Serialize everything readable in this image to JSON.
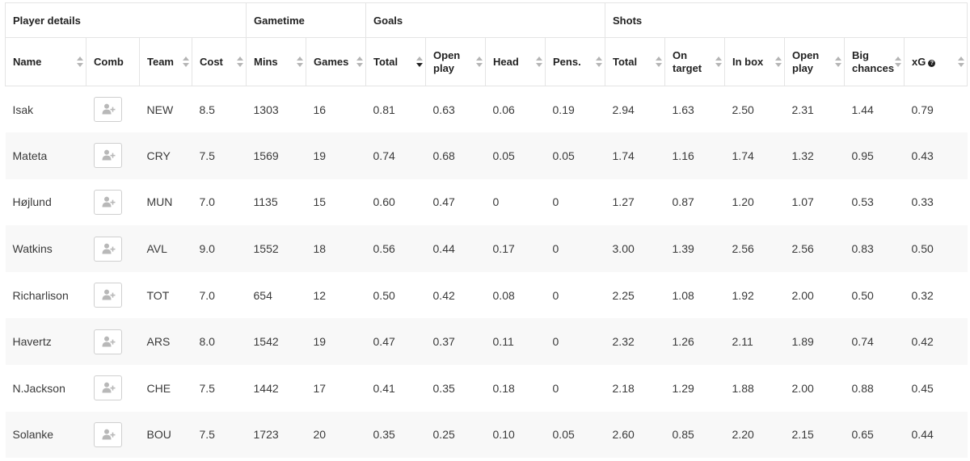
{
  "groups": [
    "Player details",
    "Gametime",
    "Goals",
    "Shots"
  ],
  "columns": [
    {
      "line1": "Name",
      "line2": ""
    },
    {
      "line1": "Comb",
      "line2": ""
    },
    {
      "line1": "Team",
      "line2": ""
    },
    {
      "line1": "Cost",
      "line2": ""
    },
    {
      "line1": "Mins",
      "line2": ""
    },
    {
      "line1": "Games",
      "line2": ""
    },
    {
      "line1": "Total",
      "line2": ""
    },
    {
      "line1": "Open",
      "line2": "play"
    },
    {
      "line1": "Head",
      "line2": ""
    },
    {
      "line1": "Pens.",
      "line2": ""
    },
    {
      "line1": "Total",
      "line2": ""
    },
    {
      "line1": "On",
      "line2": "target"
    },
    {
      "line1": "In box",
      "line2": ""
    },
    {
      "line1": "Open",
      "line2": "play"
    },
    {
      "line1": "Big",
      "line2": "chances"
    },
    {
      "line1": "xG",
      "line2": ""
    }
  ],
  "sorted_column": "goals-total",
  "sort_direction": "descending",
  "icons": {
    "comb": "add-user-icon",
    "xg_help": "help-icon"
  },
  "colors": {
    "row_alt": "#f8f8f8",
    "border": "#e4e4e4",
    "text": "#3a3a3a",
    "icon": "#b8b8b8"
  },
  "rows": [
    {
      "name": "Isak",
      "team": "NEW",
      "cost": "8.5",
      "mins": "1303",
      "games": "16",
      "goals_total": "0.81",
      "goals_open": "0.63",
      "head": "0.06",
      "pens": "0.19",
      "shots_total": "2.94",
      "on_target": "1.63",
      "in_box": "2.50",
      "shots_open": "2.31",
      "big_chances": "1.44",
      "xg": "0.79"
    },
    {
      "name": "Mateta",
      "team": "CRY",
      "cost": "7.5",
      "mins": "1569",
      "games": "19",
      "goals_total": "0.74",
      "goals_open": "0.68",
      "head": "0.05",
      "pens": "0.05",
      "shots_total": "1.74",
      "on_target": "1.16",
      "in_box": "1.74",
      "shots_open": "1.32",
      "big_chances": "0.95",
      "xg": "0.43"
    },
    {
      "name": "Højlund",
      "team": "MUN",
      "cost": "7.0",
      "mins": "1135",
      "games": "15",
      "goals_total": "0.60",
      "goals_open": "0.47",
      "head": "0",
      "pens": "0",
      "shots_total": "1.27",
      "on_target": "0.87",
      "in_box": "1.20",
      "shots_open": "1.07",
      "big_chances": "0.53",
      "xg": "0.33"
    },
    {
      "name": "Watkins",
      "team": "AVL",
      "cost": "9.0",
      "mins": "1552",
      "games": "18",
      "goals_total": "0.56",
      "goals_open": "0.44",
      "head": "0.17",
      "pens": "0",
      "shots_total": "3.00",
      "on_target": "1.39",
      "in_box": "2.56",
      "shots_open": "2.56",
      "big_chances": "0.83",
      "xg": "0.50"
    },
    {
      "name": "Richarlison",
      "team": "TOT",
      "cost": "7.0",
      "mins": "654",
      "games": "12",
      "goals_total": "0.50",
      "goals_open": "0.42",
      "head": "0.08",
      "pens": "0",
      "shots_total": "2.25",
      "on_target": "1.08",
      "in_box": "1.92",
      "shots_open": "2.00",
      "big_chances": "0.50",
      "xg": "0.32"
    },
    {
      "name": "Havertz",
      "team": "ARS",
      "cost": "8.0",
      "mins": "1542",
      "games": "19",
      "goals_total": "0.47",
      "goals_open": "0.37",
      "head": "0.11",
      "pens": "0",
      "shots_total": "2.32",
      "on_target": "1.26",
      "in_box": "2.11",
      "shots_open": "1.89",
      "big_chances": "0.74",
      "xg": "0.42"
    },
    {
      "name": "N.Jackson",
      "team": "CHE",
      "cost": "7.5",
      "mins": "1442",
      "games": "17",
      "goals_total": "0.41",
      "goals_open": "0.35",
      "head": "0.18",
      "pens": "0",
      "shots_total": "2.18",
      "on_target": "1.29",
      "in_box": "1.88",
      "shots_open": "2.00",
      "big_chances": "0.88",
      "xg": "0.45"
    },
    {
      "name": "Solanke",
      "team": "BOU",
      "cost": "7.5",
      "mins": "1723",
      "games": "20",
      "goals_total": "0.35",
      "goals_open": "0.25",
      "head": "0.10",
      "pens": "0.05",
      "shots_total": "2.60",
      "on_target": "0.85",
      "in_box": "2.20",
      "shots_open": "2.15",
      "big_chances": "0.65",
      "xg": "0.44"
    }
  ]
}
